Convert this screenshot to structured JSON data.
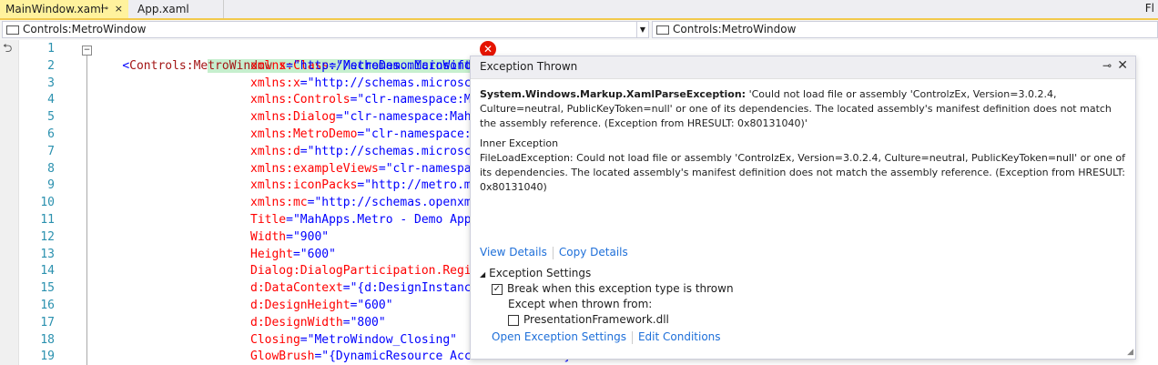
{
  "tabs": [
    {
      "label": "MainWindow.xaml",
      "active": true
    },
    {
      "label": "App.xaml",
      "active": false
    }
  ],
  "tab_pin_glyph": "⊸",
  "tab_close_glyph": "×",
  "corner_text": "Fl",
  "nav": {
    "left": "Controls:MetroWindow",
    "right": "Controls:MetroWindow"
  },
  "line_numbers": [
    "1",
    "2",
    "3",
    "4",
    "5",
    "6",
    "7",
    "8",
    "9",
    "10",
    "11",
    "12",
    "13",
    "14",
    "15",
    "16",
    "17",
    "18",
    "19"
  ],
  "code": {
    "line1": {
      "open": "<",
      "tag": "Controls:Me",
      "tag_hl": "troWindow",
      "attr": " x:Class",
      "eq": "=",
      "val": "\"MetroDemo.MainWindow\""
    },
    "attrs": [
      {
        "name": "xmlns",
        "val": "\"http://schemas.microsoft"
      },
      {
        "name": "xmlns:x",
        "val": "\"http://schemas.microsc"
      },
      {
        "name": "xmlns:Controls",
        "val": "\"clr-namespace:M"
      },
      {
        "name": "xmlns:Dialog",
        "val": "\"clr-namespace:Mah"
      },
      {
        "name": "xmlns:MetroDemo",
        "val": "\"clr-namespace:"
      },
      {
        "name": "xmlns:d",
        "val": "\"http://schemas.microsc"
      },
      {
        "name": "xmlns:exampleViews",
        "val": "\"clr-namespa"
      },
      {
        "name": "xmlns:iconPacks",
        "val": "\"http://metro.m"
      },
      {
        "name": "xmlns:mc",
        "val": "\"http://schemas.openxm"
      },
      {
        "name": "Title",
        "val": "\"MahApps.Metro - Demo App"
      },
      {
        "name": "Width",
        "val": "\"900\""
      },
      {
        "name": "Height",
        "val": "\"600\""
      },
      {
        "name": "Dialog:DialogParticipation.Regi",
        "val": ""
      },
      {
        "name": "d:DataContext",
        "val": "\"{d:DesignInstanc"
      },
      {
        "name": "d:DesignHeight",
        "val": "\"600\""
      },
      {
        "name": "d:DesignWidth",
        "val": "\"800\""
      },
      {
        "name": "Closing",
        "val": "\"MetroWindow_Closing\""
      },
      {
        "name": "GlowBrush",
        "val": "\"{DynamicResource AccentColorBrush}"
      }
    ]
  },
  "exception": {
    "title": "Exception Thrown",
    "type": "System.Windows.Markup.XamlParseException:",
    "message": " 'Could not load file or assembly 'ControlzEx, Version=3.0.2.4, Culture=neutral, PublicKeyToken=null' or one of its dependencies. The located assembly's manifest definition does not match the assembly reference. (Exception from HRESULT: 0x80131040)'",
    "inner_heading": "Inner Exception",
    "inner_message": "FileLoadException: Could not load file or assembly 'ControlzEx, Version=3.0.2.4, Culture=neutral, PublicKeyToken=null' or one of its dependencies. The located assembly's manifest definition does not match the assembly reference. (Exception from HRESULT: 0x80131040)",
    "view_details": "View Details",
    "copy_details": "Copy Details",
    "settings_heading": "Exception Settings",
    "break_label": "Break when this exception type is thrown",
    "break_checked": true,
    "except_label": "Except when thrown from:",
    "pf_label": "PresentationFramework.dll",
    "pf_checked": false,
    "open_settings": "Open Exception Settings",
    "edit_conditions": "Edit Conditions"
  }
}
